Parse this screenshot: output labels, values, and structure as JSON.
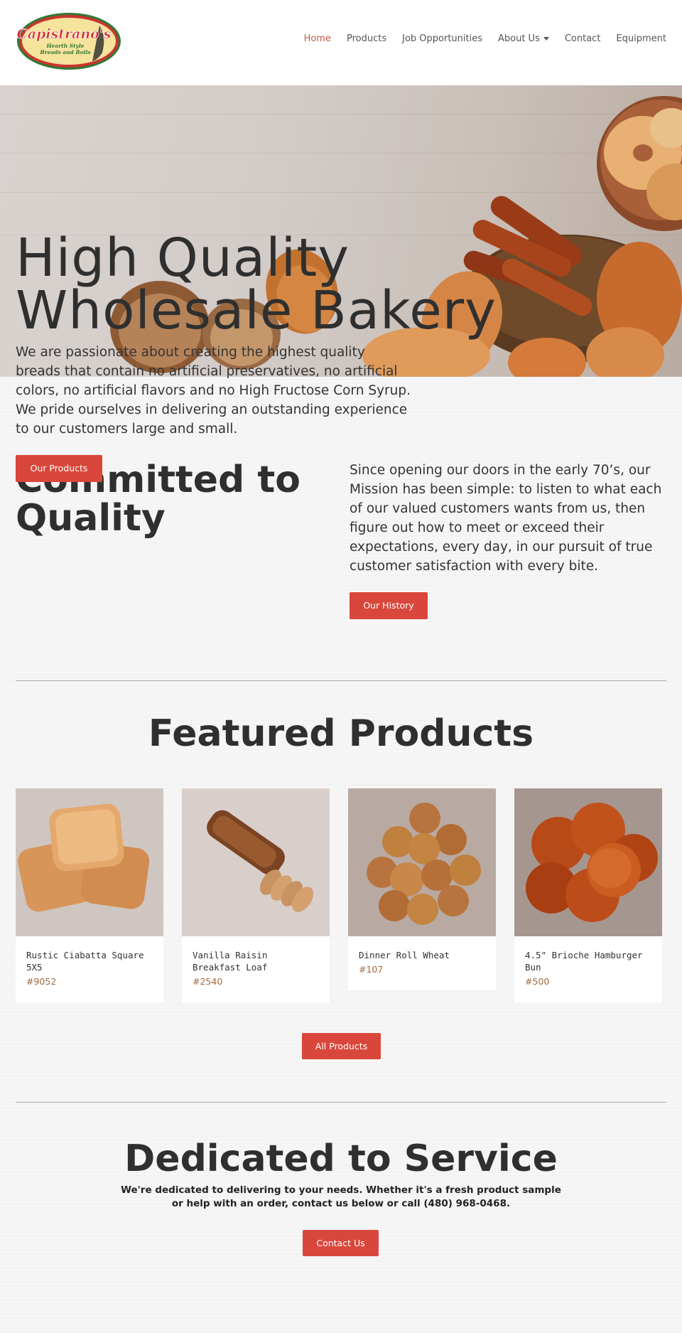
{
  "brand": {
    "logo_name": "Capistrano's",
    "logo_tagline_1": "Hearth Style",
    "logo_tagline_2": "Breads and Rolls"
  },
  "nav": {
    "items": [
      {
        "label": "Home",
        "active": true
      },
      {
        "label": "Products"
      },
      {
        "label": "Job Opportunities"
      },
      {
        "label": "About Us",
        "has_dropdown": true
      },
      {
        "label": "Contact"
      },
      {
        "label": "Equipment"
      }
    ]
  },
  "hero": {
    "title": "High Quality Wholesale Bakery",
    "description": "We are passionate about creating the highest quality breads that contain no artificial preservatives, no artificial colors, no artificial flavors and no High Fructose Corn Syrup. We pride ourselves in delivering an outstanding experience to our customers large and small.",
    "button_label": "Our Products"
  },
  "committed": {
    "title": "Committed to Quality",
    "text": "Since opening our doors in the early 70’s, our Mission has been simple: to listen to what each of our valued customers wants from us, then figure out how to meet or exceed their expectations, every day, in our pursuit of true customer satisfaction with every bite.",
    "button_label": "Our History"
  },
  "featured": {
    "title": "Featured Products",
    "products": [
      {
        "name": "Rustic Ciabatta Square 5X5",
        "sku": "#9052"
      },
      {
        "name": "Vanilla Raisin Breakfast Loaf",
        "sku": "#2540"
      },
      {
        "name": "Dinner Roll Wheat",
        "sku": "#107"
      },
      {
        "name": "4.5\" Brioche Hamburger Bun",
        "sku": "#500"
      }
    ],
    "button_label": "All Products"
  },
  "service": {
    "title": "Dedicated to Service",
    "text": "We're dedicated to delivering to your needs. Whether it's a fresh product sample or help with an order, contact us below or call (480) 968-0468.",
    "button_label": "Contact Us"
  },
  "colors": {
    "accent": "#d9473c",
    "nav_active": "#c65a48",
    "sku": "#a26a3e",
    "text": "#333333"
  }
}
